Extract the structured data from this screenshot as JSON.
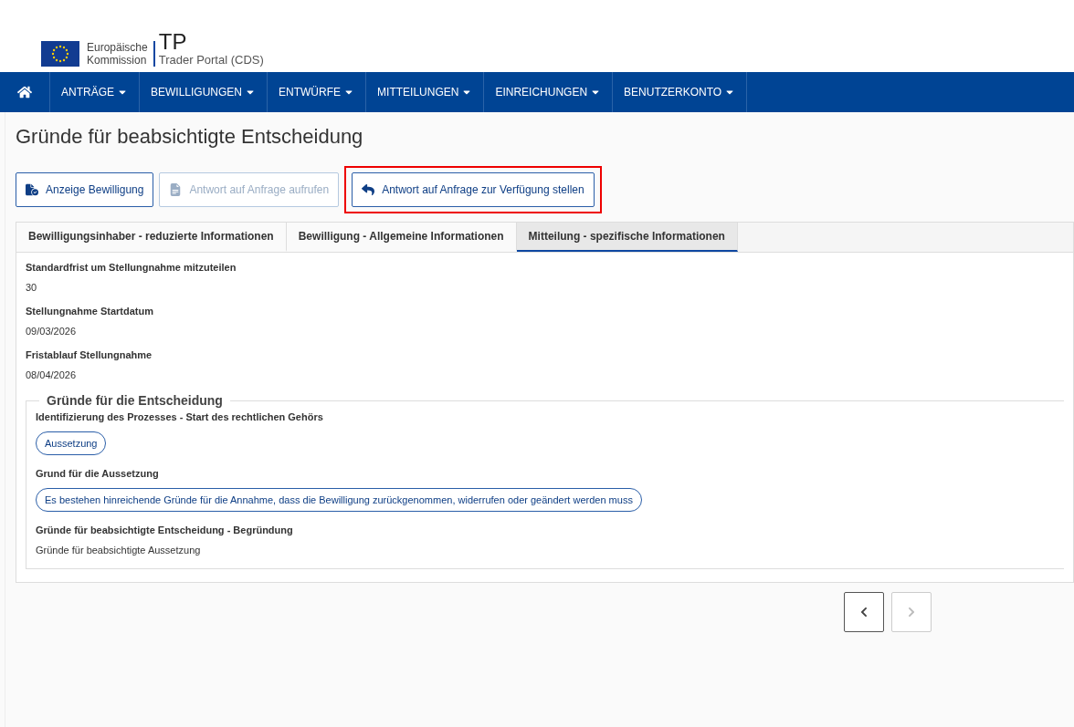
{
  "header": {
    "org_line1": "Europäische",
    "org_line2": "Kommission",
    "app_title": "TP",
    "app_subtitle": "Trader Portal (CDS)"
  },
  "nav": {
    "items": [
      {
        "label": "ANTRÄGE"
      },
      {
        "label": "BEWILLIGUNGEN"
      },
      {
        "label": "ENTWÜRFE"
      },
      {
        "label": "MITTEILUNGEN"
      },
      {
        "label": "EINREICHUNGEN"
      },
      {
        "label": "BENUTZERKONTO"
      }
    ]
  },
  "page_title": "Gründe für beabsichtigte Entscheidung",
  "actions": [
    {
      "label": "Anzeige Bewilligung",
      "kind": "file",
      "disabled": false,
      "highlighted": false
    },
    {
      "label": "Antwort auf Anfrage aufrufen",
      "kind": "doc",
      "disabled": true,
      "highlighted": false
    },
    {
      "label": "Antwort auf Anfrage zur Verfügung stellen",
      "kind": "reply",
      "disabled": false,
      "highlighted": true
    }
  ],
  "tabs": [
    {
      "label": "Bewilligungsinhaber - reduzierte Informationen",
      "selected": false
    },
    {
      "label": "Bewilligung - Allgemeine Informationen",
      "selected": false
    },
    {
      "label": "Mitteilung - spezifische Informationen",
      "selected": true
    }
  ],
  "fields": [
    {
      "label": "Standardfrist um Stellungnahme mitzuteilen",
      "value": "30"
    },
    {
      "label": "Stellungnahme Startdatum",
      "value": "09/03/2026"
    },
    {
      "label": "Fristablauf Stellungnahme",
      "value": "08/04/2026"
    }
  ],
  "reasons": {
    "legend": "Gründe für die Entscheidung",
    "items": [
      {
        "label": "Identifizierung des Prozesses - Start des rechtlichen Gehörs",
        "value": "Aussetzung",
        "kind": "pill"
      },
      {
        "label": "Grund für die Aussetzung",
        "value": "Es bestehen hinreichende Gründe für die Annahme, dass die Bewilligung zurückgenommen, widerrufen oder geändert werden muss",
        "kind": "pill"
      },
      {
        "label": "Gründe für beabsichtigte Entscheidung - Begründung",
        "value": "Gründe für beabsichtigte Aussetzung",
        "kind": "text"
      }
    ]
  },
  "pager": [
    {
      "kind": "prev",
      "disabled": false
    },
    {
      "kind": "next",
      "disabled": true
    }
  ]
}
